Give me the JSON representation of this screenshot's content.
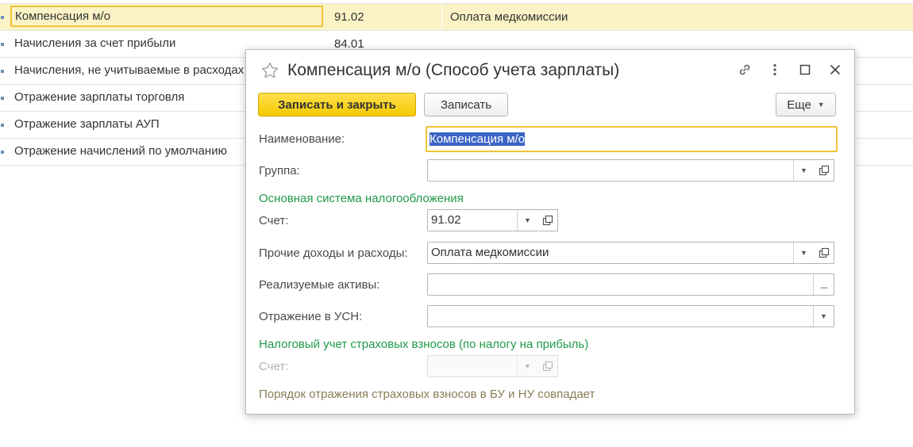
{
  "list": {
    "rows": [
      {
        "name": "Компенсация м/о",
        "account": "91.02",
        "expense": "Оплата медкомиссии"
      },
      {
        "name": "Начисления за счет прибыли",
        "account": "84.01",
        "expense": ""
      },
      {
        "name": "Начисления, не учитываемые в расходах",
        "account": "",
        "expense": ""
      },
      {
        "name": "Отражение зарплаты торговля",
        "account": "",
        "expense": ""
      },
      {
        "name": "Отражение зарплаты АУП",
        "account": "",
        "expense": ""
      },
      {
        "name": "Отражение начислений по умолчанию",
        "account": "",
        "expense": ""
      }
    ]
  },
  "dialog": {
    "title": "Компенсация м/о (Способ учета зарплаты)",
    "toolbar": {
      "save_close": "Записать и закрыть",
      "save": "Записать",
      "more": "Еще"
    },
    "fields": {
      "name_label": "Наименование:",
      "name_value": "Компенсация м/о",
      "group_label": "Группа:",
      "group_value": "",
      "section_main": "Основная система налогообложения",
      "account_label": "Счет:",
      "account_value": "91.02",
      "other_label": "Прочие доходы и расходы:",
      "other_value": "Оплата медкомиссии",
      "assets_label": "Реализуемые активы:",
      "assets_value": "",
      "usn_label": "Отражение в УСН:",
      "usn_value": "",
      "section_tax": "Налоговый учет страховых взносов (по налогу на прибыль)",
      "tax_account_label": "Счет:",
      "tax_account_value": "",
      "note": "Порядок отражения страховых взносов в БУ и НУ совпадает"
    },
    "icons": [
      "star-icon",
      "link-icon",
      "more-vertical-icon",
      "maximize-icon",
      "close-icon",
      "dropdown-arrow-icon",
      "open-form-icon",
      "ellipsis-icon"
    ]
  },
  "colors": {
    "primary_button": "#f5c900",
    "selection_row": "#fbf3c5",
    "focus_border": "#f0c43a",
    "section_title": "#1f9a4a",
    "note_text": "#8a7d55",
    "text_highlight": "#3b64c4"
  }
}
